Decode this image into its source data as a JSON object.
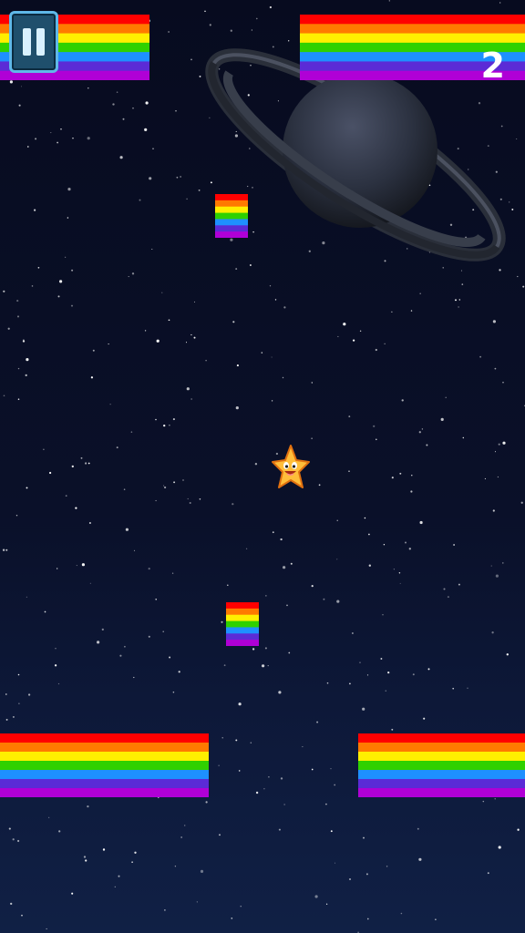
{
  "hud": {
    "score": "2",
    "pause_icon": "pause-icon"
  },
  "colors": {
    "rainbow": [
      "#ff0000",
      "#ff7a00",
      "#ffef00",
      "#2fd100",
      "#1e90ff",
      "#5b2bd6",
      "#b000d6"
    ]
  },
  "player": {
    "icon": "smiling-star-icon"
  },
  "scene": {
    "planet": "ringed-planet"
  }
}
